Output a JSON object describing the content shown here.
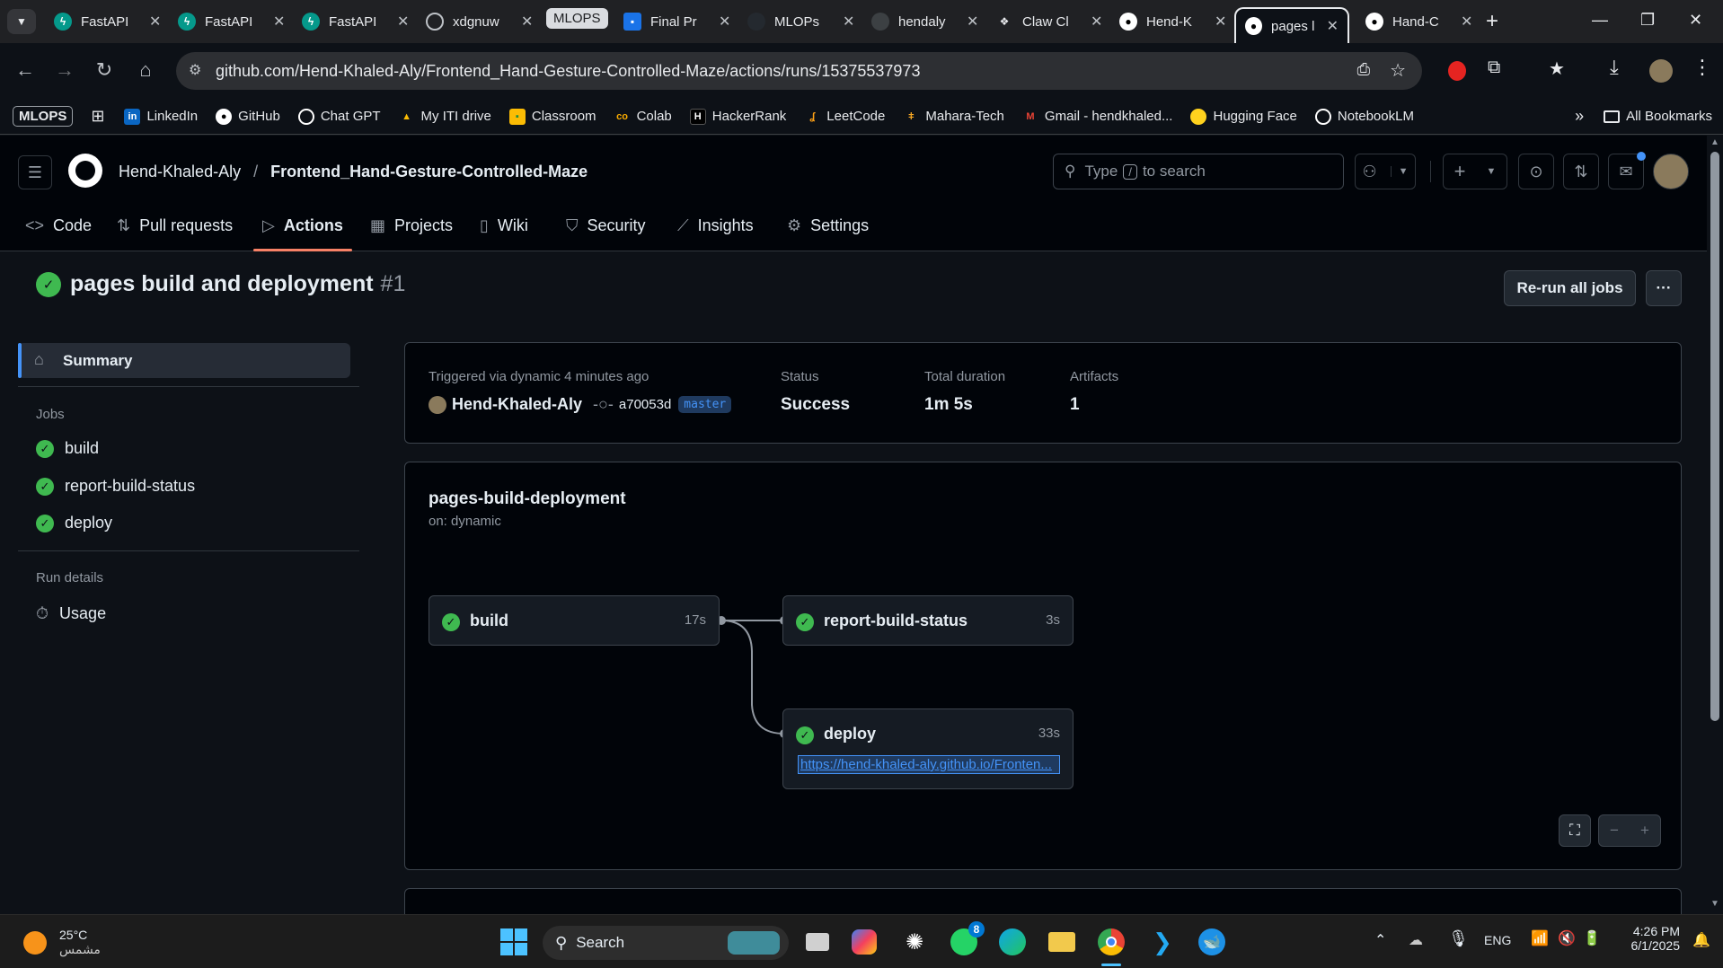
{
  "browser": {
    "tabs": [
      {
        "title": "FastAPI",
        "favicon": "fastapi-icon",
        "color": "#05998b"
      },
      {
        "title": "FastAPI",
        "favicon": "fastapi-icon",
        "color": "#05998b"
      },
      {
        "title": "FastAPI",
        "favicon": "fastapi-icon",
        "color": "#05998b"
      },
      {
        "title": "xdgnuw",
        "favicon": "globe-icon",
        "color": "#5f6368"
      },
      {
        "title": "Final Pr",
        "favicon": "classroom-icon",
        "color": "#1a73e8"
      },
      {
        "title": "MLOPs",
        "favicon": "github-icon",
        "color": "#24292f"
      },
      {
        "title": "hendaly",
        "favicon": "globe-icon",
        "color": "#5f6368"
      },
      {
        "title": "Claw Cl",
        "favicon": "paw-icon",
        "color": "#000000"
      },
      {
        "title": "Hend-K",
        "favicon": "github-icon",
        "color": "#ffffff"
      },
      {
        "title": "pages l",
        "favicon": "github-actions-icon",
        "color": "#ffffff"
      },
      {
        "title": "Hand-C",
        "favicon": "github-icon",
        "color": "#ffffff"
      }
    ],
    "tab_group_label": "MLOPS",
    "url": "github.com/Hend-Khaled-Aly/Frontend_Hand-Gesture-Controlled-Maze/actions/runs/15375537973",
    "bookmarks": [
      {
        "label": "MLOPS",
        "icon": "folder-group-icon"
      },
      {
        "label": "LinkedIn",
        "icon": "linkedin-icon",
        "color": "#0a66c2"
      },
      {
        "label": "GitHub",
        "icon": "github-icon",
        "color": "#ffffff"
      },
      {
        "label": "Chat GPT",
        "icon": "openai-icon",
        "color": "#ffffff"
      },
      {
        "label": "My ITI drive",
        "icon": "drive-icon",
        "color": "#fbbc04"
      },
      {
        "label": "Classroom",
        "icon": "classroom-icon",
        "color": "#fbbc04"
      },
      {
        "label": "Colab",
        "icon": "colab-icon",
        "color": "#f9ab00"
      },
      {
        "label": "HackerRank",
        "icon": "hackerrank-icon",
        "color": "#000000"
      },
      {
        "label": "LeetCode",
        "icon": "leetcode-icon",
        "color": "#ffa116"
      },
      {
        "label": "Mahara-Tech",
        "icon": "mahara-icon",
        "color": "#f5a623"
      },
      {
        "label": "Gmail - hendkhaled...",
        "icon": "gmail-icon",
        "color": "#ea4335"
      },
      {
        "label": "Hugging Face",
        "icon": "huggingface-icon",
        "color": "#ffd21e"
      },
      {
        "label": "NotebookLM",
        "icon": "notebooklm-icon",
        "color": "#ffffff"
      }
    ],
    "all_bookmarks": "All Bookmarks"
  },
  "github": {
    "owner": "Hend-Khaled-Aly",
    "repo": "Frontend_Hand-Gesture-Controlled-Maze",
    "search_placeholder": "Type / to search",
    "search_type": "Type",
    "search_key": "/",
    "search_rest": "to search",
    "repo_tabs": [
      {
        "label": "Code",
        "icon": "code-icon"
      },
      {
        "label": "Pull requests",
        "icon": "pull-request-icon"
      },
      {
        "label": "Actions",
        "icon": "play-icon",
        "active": true
      },
      {
        "label": "Projects",
        "icon": "table-icon"
      },
      {
        "label": "Wiki",
        "icon": "book-icon"
      },
      {
        "label": "Security",
        "icon": "shield-icon"
      },
      {
        "label": "Insights",
        "icon": "graph-icon"
      },
      {
        "label": "Settings",
        "icon": "gear-icon"
      }
    ]
  },
  "run": {
    "title": "pages build and deployment",
    "number": "#1",
    "rerun_label": "Re-run all jobs",
    "sidebar": {
      "summary": "Summary",
      "jobs_heading": "Jobs",
      "jobs": [
        "build",
        "report-build-status",
        "deploy"
      ],
      "run_details_heading": "Run details",
      "usage": "Usage"
    },
    "summary": {
      "trigger": "Triggered via dynamic 4 minutes ago",
      "actor": "Hend-Khaled-Aly",
      "commit": "a70053d",
      "branch": "master",
      "status_label": "Status",
      "status_value": "Success",
      "duration_label": "Total duration",
      "duration_value": "1m 5s",
      "artifacts_label": "Artifacts",
      "artifacts_value": "1"
    },
    "workflow": {
      "name": "pages-build-deployment",
      "on": "on: dynamic",
      "jobs": {
        "build": {
          "name": "build",
          "duration": "17s"
        },
        "report": {
          "name": "report-build-status",
          "duration": "3s"
        },
        "deploy": {
          "name": "deploy",
          "duration": "33s",
          "link": "https://hend-khaled-aly.github.io/Fronten..."
        }
      }
    }
  },
  "taskbar": {
    "weather_temp": "25°C",
    "weather_desc": "مشمس",
    "search": "Search",
    "lang": "ENG",
    "time": "4:26 PM",
    "date": "6/1/2025",
    "whatsapp_badge": "8"
  },
  "colors": {
    "success": "#3fb950",
    "accent": "#f78166",
    "link": "#4493f8"
  }
}
